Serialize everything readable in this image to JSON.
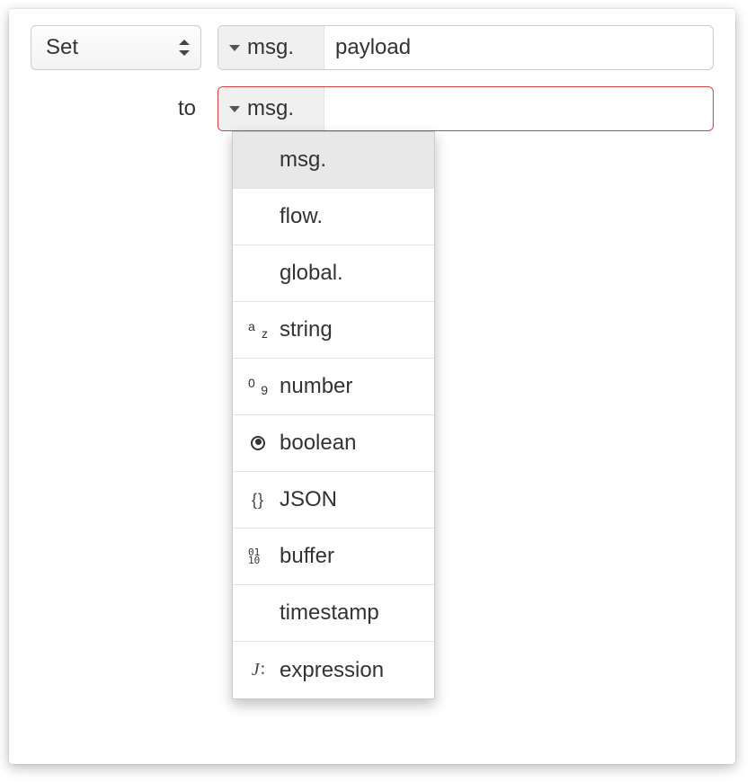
{
  "operation": {
    "selected": "Set"
  },
  "property_input": {
    "prefix": "msg.",
    "value": "payload"
  },
  "to_label": "to",
  "value_input": {
    "prefix": "msg.",
    "value": ""
  },
  "type_menu": {
    "selected_index": 0,
    "items": [
      {
        "label": "msg.",
        "icon": ""
      },
      {
        "label": "flow.",
        "icon": ""
      },
      {
        "label": "global.",
        "icon": ""
      },
      {
        "label": "string",
        "icon": "az"
      },
      {
        "label": "number",
        "icon": "09"
      },
      {
        "label": "boolean",
        "icon": "bool"
      },
      {
        "label": "JSON",
        "icon": "json"
      },
      {
        "label": "buffer",
        "icon": "buf"
      },
      {
        "label": "timestamp",
        "icon": ""
      },
      {
        "label": "expression",
        "icon": "expr"
      }
    ]
  }
}
